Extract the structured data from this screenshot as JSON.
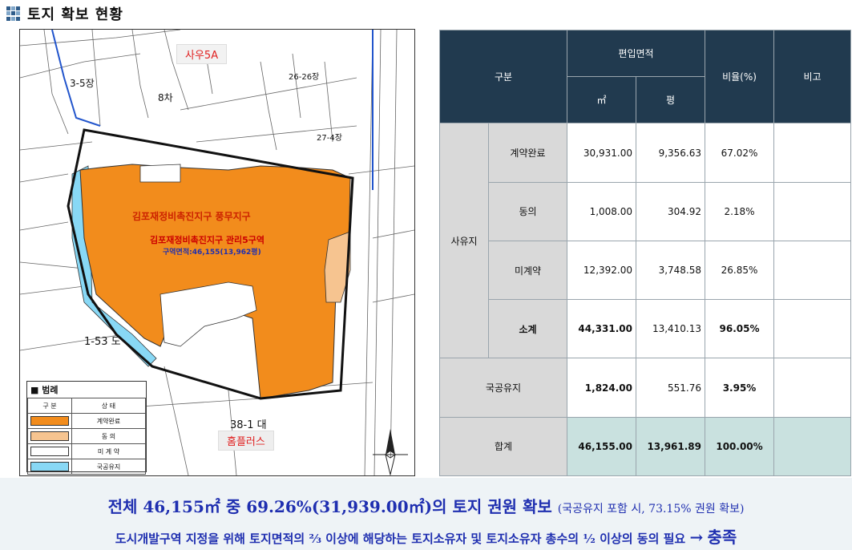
{
  "header": {
    "title": "토지 확보 현황"
  },
  "map": {
    "labels": {
      "top": "사우5A",
      "bottom": "홈플러스",
      "zone_upper": "김포재정비촉진지구 풍무지구",
      "zone_main": "김포재정비촉진지구 관리5구역",
      "zone_area": "구역면적:46,155(13,962평)",
      "parcel_38_1": "38-1  대",
      "parcel_1_53": "1-53  도",
      "parcel_3_5": "3-5장",
      "parcel_8": "8차",
      "parcel_27_4": "27-4장",
      "parcel_26_26": "26-26장"
    },
    "legend": {
      "title": "■ 범례",
      "col1": "구  분",
      "col2": "상  태",
      "rows": [
        {
          "label": "계약완료",
          "color": "#f28c1c"
        },
        {
          "label": "동  의",
          "color": "#f6c490"
        },
        {
          "label": "미 계 약",
          "color": "#ffffff"
        },
        {
          "label": "국공유지",
          "color": "#88d8f5"
        }
      ]
    }
  },
  "table": {
    "headers": {
      "category": "구분",
      "area": "편입면적",
      "sqm": "㎡",
      "pyeong": "평",
      "ratio": "비율(%)",
      "note": "비고"
    },
    "private_label": "사유지",
    "rows": [
      {
        "label": "계약완료",
        "sqm": "30,931.00",
        "pyeong": "9,356.63",
        "ratio": "67.02%"
      },
      {
        "label": "동의",
        "sqm": "1,008.00",
        "pyeong": "304.92",
        "ratio": "2.18%"
      },
      {
        "label": "미계약",
        "sqm": "12,392.00",
        "pyeong": "3,748.58",
        "ratio": "26.85%"
      },
      {
        "label": "소계",
        "sqm": "44,331.00",
        "pyeong": "13,410.13",
        "ratio": "96.05%"
      }
    ],
    "public_row": {
      "label": "국공유지",
      "sqm": "1,824.00",
      "pyeong": "551.76",
      "ratio": "3.95%"
    },
    "total_row": {
      "label": "합계",
      "sqm": "46,155.00",
      "pyeong": "13,961.89",
      "ratio": "100.00%"
    }
  },
  "summary": {
    "line1_main": "전체 46,155㎡ 중 69.26%(31,939.00㎡)의 토지 권원 확보",
    "line1_note": "(국공유지 포함 시, 73.15% 권원 확보)",
    "line2_main": "도시개발구역 지정을 위해 토지면적의 ⅔ 이상에 해당하는 토지소유자 및 토지소유자 총수의 ½ 이상의 동의 필요",
    "line2_arrow": "→",
    "line2_result": "충족"
  }
}
